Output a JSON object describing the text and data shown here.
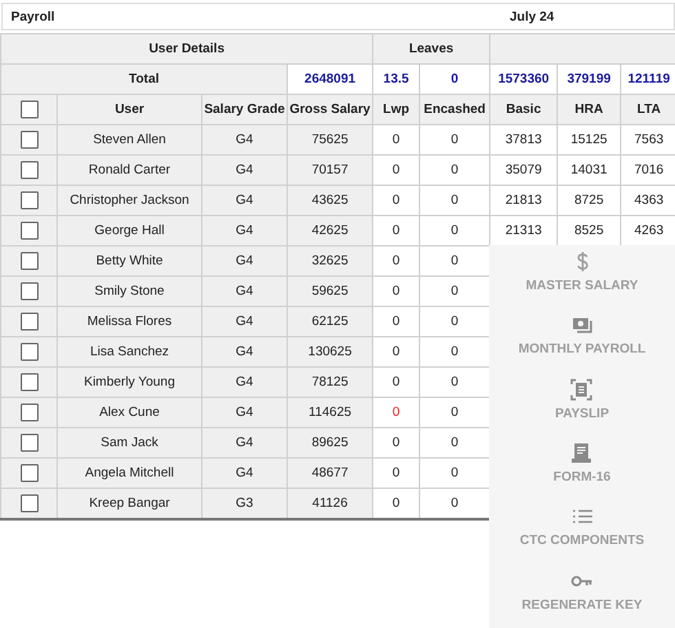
{
  "title_bar": {
    "title": "Payroll",
    "period": "July 24"
  },
  "groups": {
    "user_details": "User Details",
    "leaves": "Leaves"
  },
  "totals": {
    "label": "Total",
    "gross_salary": "2648091",
    "lwp": "13.5",
    "encashed": "0",
    "basic": "1573360",
    "hra": "379199",
    "lta": "121119"
  },
  "select_all": {
    "checked": false
  },
  "columns": [
    "User",
    "Salary Grade",
    "Gross Salary",
    "Lwp",
    "Encashed",
    "Basic",
    "HRA",
    "LTA"
  ],
  "rows": [
    {
      "checked": false,
      "user": "Steven Allen",
      "grade": "G4",
      "gross": "75625",
      "lwp": "0",
      "lwp_flagged": false,
      "encashed": "0",
      "basic": "37813",
      "hra": "15125",
      "lta": "7563"
    },
    {
      "checked": false,
      "user": "Ronald Carter",
      "grade": "G4",
      "gross": "70157",
      "lwp": "0",
      "lwp_flagged": false,
      "encashed": "0",
      "basic": "35079",
      "hra": "14031",
      "lta": "7016"
    },
    {
      "checked": false,
      "user": "Christopher Jackson",
      "grade": "G4",
      "gross": "43625",
      "lwp": "0",
      "lwp_flagged": false,
      "encashed": "0",
      "basic": "21813",
      "hra": "8725",
      "lta": "4363"
    },
    {
      "checked": false,
      "user": "George Hall",
      "grade": "G4",
      "gross": "42625",
      "lwp": "0",
      "lwp_flagged": false,
      "encashed": "0",
      "basic": "21313",
      "hra": "8525",
      "lta": "4263"
    },
    {
      "checked": false,
      "user": "Betty White",
      "grade": "G4",
      "gross": "32625",
      "lwp": "0",
      "lwp_flagged": false,
      "encashed": "0"
    },
    {
      "checked": false,
      "user": "Smily Stone",
      "grade": "G4",
      "gross": "59625",
      "lwp": "0",
      "lwp_flagged": false,
      "encashed": "0"
    },
    {
      "checked": false,
      "user": "Melissa Flores",
      "grade": "G4",
      "gross": "62125",
      "lwp": "0",
      "lwp_flagged": false,
      "encashed": "0"
    },
    {
      "checked": false,
      "user": "Lisa Sanchez",
      "grade": "G4",
      "gross": "130625",
      "lwp": "0",
      "lwp_flagged": false,
      "encashed": "0"
    },
    {
      "checked": false,
      "user": "Kimberly Young",
      "grade": "G4",
      "gross": "78125",
      "lwp": "0",
      "lwp_flagged": false,
      "encashed": "0"
    },
    {
      "checked": false,
      "user": "Alex Cune",
      "grade": "G4",
      "gross": "114625",
      "lwp": "0",
      "lwp_flagged": true,
      "encashed": "0"
    },
    {
      "checked": false,
      "user": "Sam Jack",
      "grade": "G4",
      "gross": "89625",
      "lwp": "0",
      "lwp_flagged": false,
      "encashed": "0"
    },
    {
      "checked": false,
      "user": "Angela Mitchell",
      "grade": "G4",
      "gross": "48677",
      "lwp": "0",
      "lwp_flagged": false,
      "encashed": "0"
    },
    {
      "checked": false,
      "user": "Kreep Bangar",
      "grade": "G3",
      "gross": "41126",
      "lwp": "0",
      "lwp_flagged": false,
      "encashed": "0"
    }
  ],
  "menu": [
    {
      "kind": "dollar",
      "label": "MASTER SALARY"
    },
    {
      "kind": "cash",
      "label": "MONTHLY PAYROLL"
    },
    {
      "kind": "scan",
      "label": "PAYSLIP"
    },
    {
      "kind": "receipt",
      "label": "FORM-16"
    },
    {
      "kind": "list",
      "label": "CTC COMPONENTS"
    },
    {
      "kind": "key",
      "label": "REGENERATE KEY"
    }
  ]
}
